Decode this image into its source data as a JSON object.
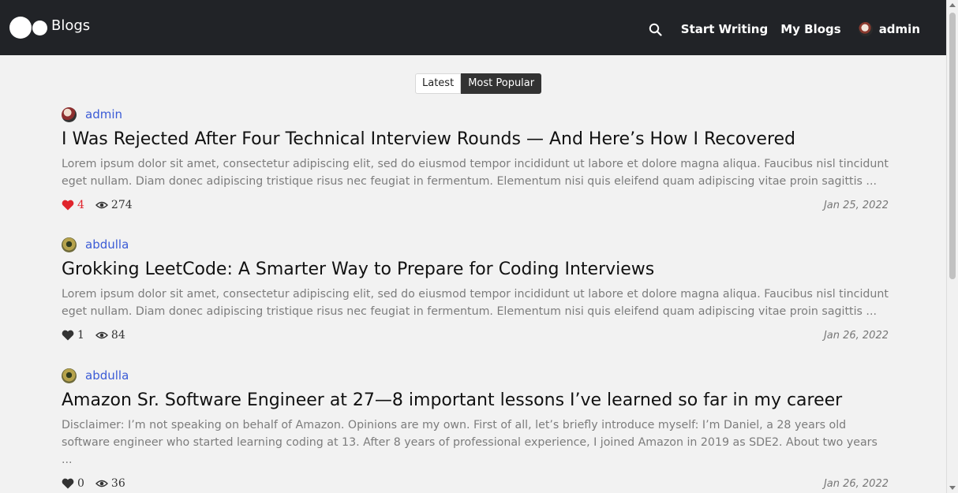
{
  "brand": {
    "name": "Blogs"
  },
  "nav": {
    "start_writing": "Start Writing",
    "my_blogs": "My Blogs",
    "user": "admin"
  },
  "tabs": [
    {
      "label": "Latest",
      "active": false
    },
    {
      "label": "Most Popular",
      "active": true
    }
  ],
  "posts": [
    {
      "author": "admin",
      "title": "I Was Rejected After Four Technical Interview Rounds — And Here’s How I Recovered",
      "excerpt": "Lorem ipsum dolor sit amet, consectetur adipiscing elit, sed do eiusmod tempor incididunt ut labore et dolore magna aliqua. Faucibus nisl tincidunt eget nullam. Diam donec adipiscing tristique risus nec feugiat in fermentum. Elementum nisi quis eleifend quam adipiscing vitae proin sagittis ...",
      "likes": "4",
      "views": "274",
      "date": "Jan 25, 2022",
      "liked": true
    },
    {
      "author": "abdulla",
      "title": "Grokking LeetCode: A Smarter Way to Prepare for Coding Interviews",
      "excerpt": "Lorem ipsum dolor sit amet, consectetur adipiscing elit, sed do eiusmod tempor incididunt ut labore et dolore magna aliqua. Faucibus nisl tincidunt eget nullam. Diam donec adipiscing tristique risus nec feugiat in fermentum. Elementum nisi quis eleifend quam adipiscing vitae proin sagittis ...",
      "likes": "1",
      "views": "84",
      "date": "Jan 26, 2022",
      "liked": false
    },
    {
      "author": "abdulla",
      "title": "Amazon Sr. Software Engineer at 27—8 important lessons I’ve learned so far in my career",
      "excerpt": "Disclaimer: I’m not speaking on behalf of Amazon. Opinions are my own. First of all, let’s briefly introduce myself: I’m Daniel, a 28 years old software engineer who started learning coding at 13. After 8 years of professional experience, I joined Amazon in 2019 as SDE2. About two years ...",
      "likes": "0",
      "views": "36",
      "date": "Jan 26, 2022",
      "liked": false
    }
  ],
  "icons": {
    "search": "search-icon",
    "heart": "heart-icon",
    "eye": "eye-icon"
  },
  "colors": {
    "navbar": "#212327",
    "author_link": "#3b5bd6",
    "liked_heart": "#e0242c",
    "heart": "#333333"
  }
}
